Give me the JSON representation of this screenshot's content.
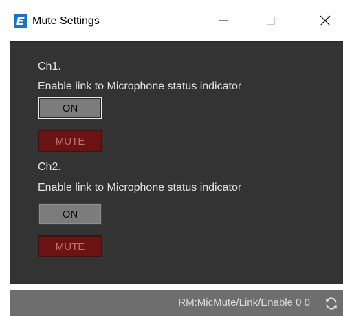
{
  "window": {
    "title": "Mute Settings",
    "app_icon": "app-logo-icon",
    "caption_buttons": [
      "minimize-icon",
      "maximize-icon",
      "close-icon"
    ]
  },
  "channels": [
    {
      "label": "Ch1.",
      "description": "Enable link to Microphone status indicator",
      "on_label": "ON",
      "mute_label": "MUTE"
    },
    {
      "label": "Ch2.",
      "description": "Enable link to Microphone status indicator",
      "on_label": "ON",
      "mute_label": "MUTE"
    }
  ],
  "statusbar": {
    "text": "RM:MicMute/Link/Enable 0 0",
    "icon": "refresh-icon"
  },
  "colors": {
    "accent": "#1a73c8",
    "panel_background": "#333333",
    "mute_red": "#6d1212",
    "on_gray": "#7c7c7c",
    "statusbar": "#6e6e6e"
  }
}
